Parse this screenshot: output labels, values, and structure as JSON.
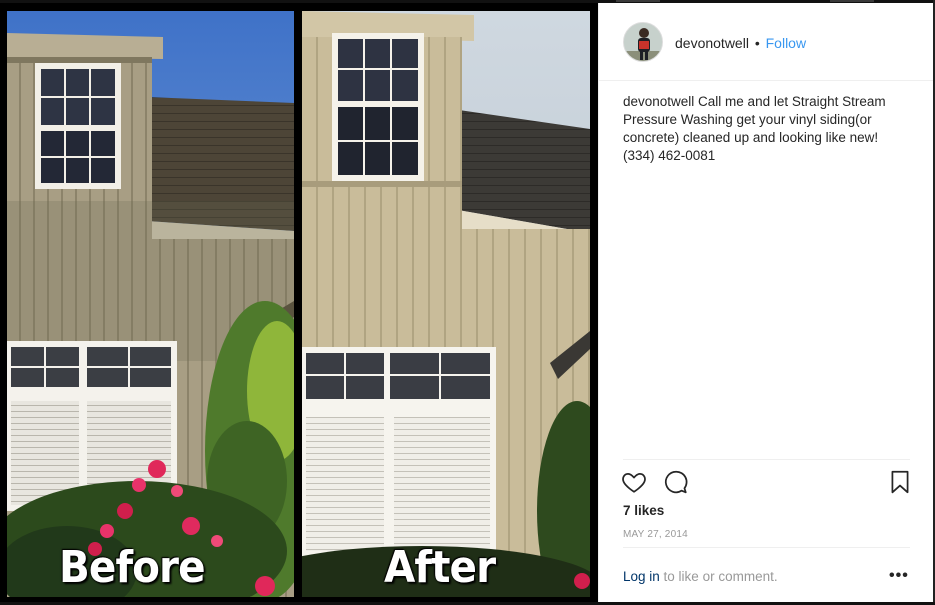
{
  "post": {
    "username": "devonotwell",
    "dot": "•",
    "follow_label": "Follow",
    "caption_user": "devonotwell",
    "caption_text": " Call me and let Straight Stream Pressure Washing get your vinyl siding(or concrete) cleaned up and looking like new! (334) 462-0081",
    "likes": "7 likes",
    "date": "MAY 27, 2014",
    "login_link": "Log in",
    "login_rest": " to like or comment.",
    "more": "•••"
  },
  "image": {
    "before_label": "Before",
    "after_label": "After"
  },
  "colors": {
    "link_blue": "#3897f0",
    "login_navy": "#003569",
    "text": "#262626",
    "muted": "#999999"
  },
  "icons": {
    "like": "heart-icon",
    "comment": "comment-icon",
    "save": "bookmark-icon",
    "more": "more-options-icon"
  }
}
